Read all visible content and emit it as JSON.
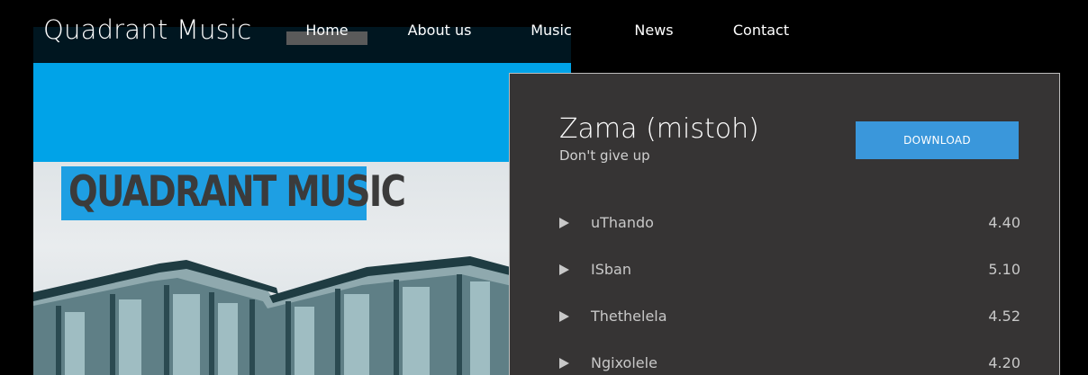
{
  "site": {
    "title": "Quadrant Music"
  },
  "nav": {
    "items": [
      {
        "label": "Home",
        "active": true
      },
      {
        "label": "About us",
        "active": false
      },
      {
        "label": "Music",
        "active": false
      },
      {
        "label": "News",
        "active": false
      },
      {
        "label": "Contact",
        "active": false
      }
    ]
  },
  "hero": {
    "logo_text": "QUADRANT MUSIC"
  },
  "player": {
    "album_title": "Zama (mistoh)",
    "album_subtitle": "Don't give up",
    "download_label": "DOWNLOAD",
    "tracks": [
      {
        "name": "uThando",
        "duration": "4.40"
      },
      {
        "name": "ISban",
        "duration": "5.10"
      },
      {
        "name": "Thethelela",
        "duration": "4.52"
      },
      {
        "name": "Ngixolele",
        "duration": "4.20"
      }
    ]
  },
  "colors": {
    "background": "#000000",
    "header_bar": "#001620",
    "sky": "#00a3e8",
    "player_bg": "#363434",
    "download_button": "#3a97db",
    "nav_active": "#5a5a5a"
  }
}
